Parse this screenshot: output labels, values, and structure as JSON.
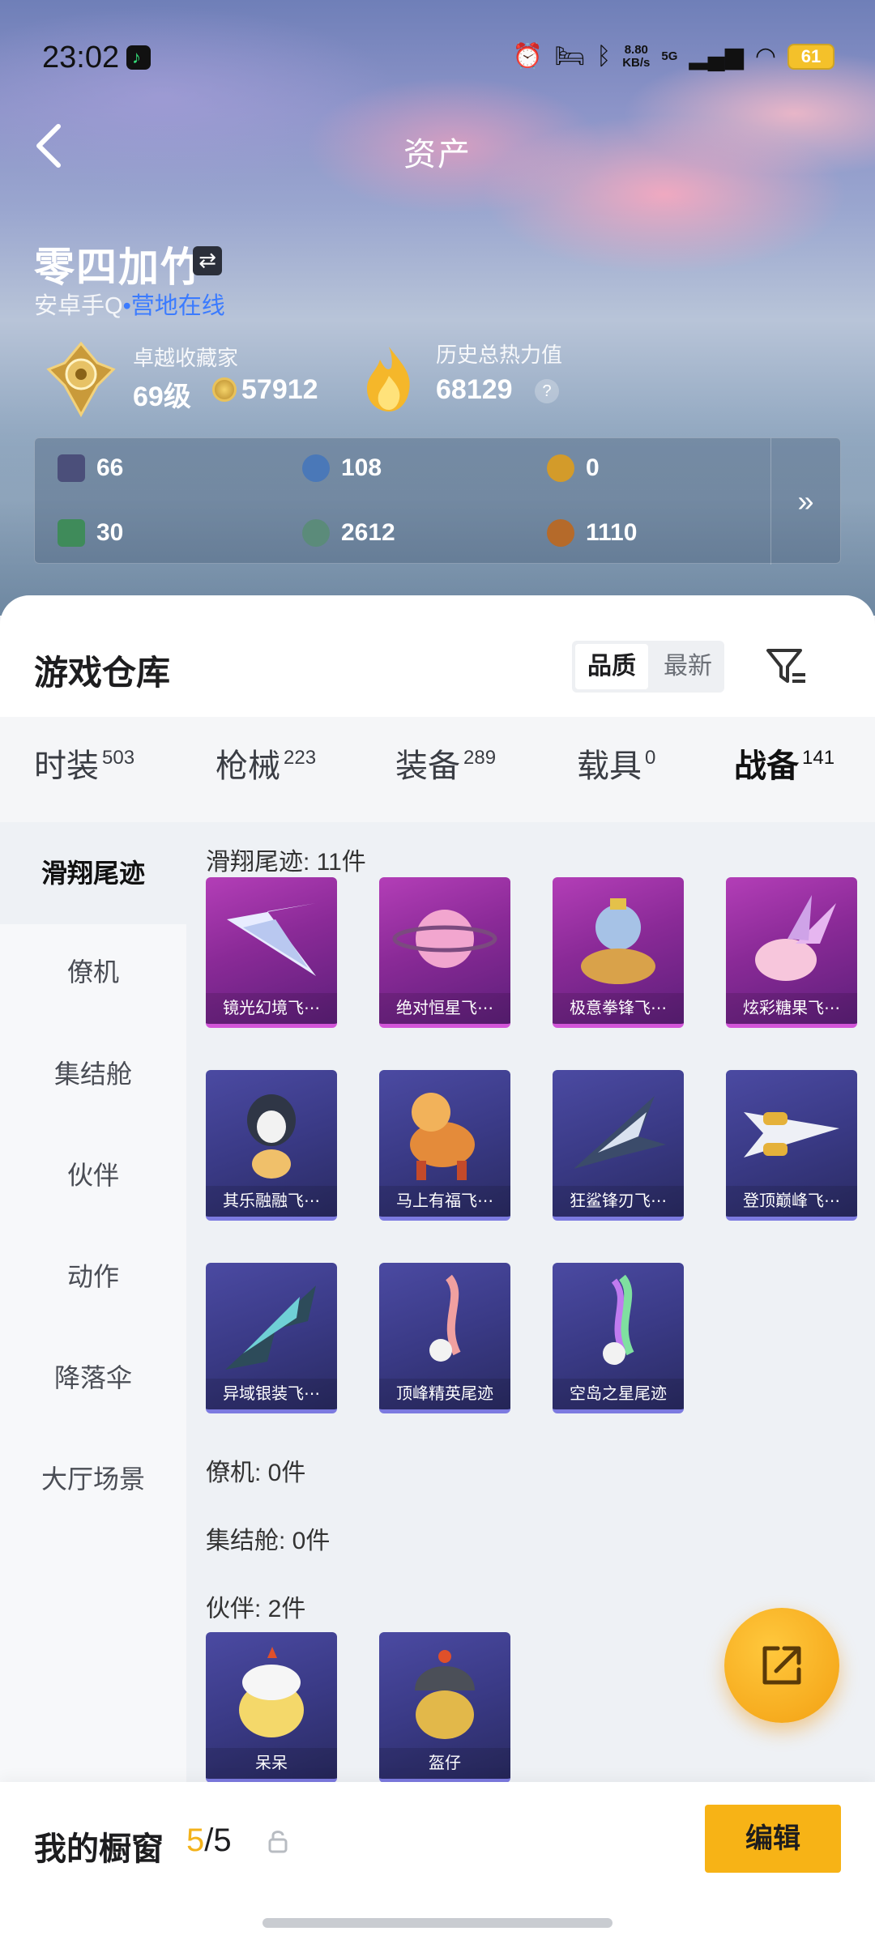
{
  "status_bar": {
    "time": "23:02",
    "net_speed_value": "8.80",
    "net_speed_unit": "KB/s",
    "network": "5G",
    "battery": "61",
    "icons": [
      "alarm-icon",
      "bed-icon",
      "bluetooth-icon",
      "signal-icon",
      "wifi-icon"
    ]
  },
  "header": {
    "title": "资产"
  },
  "profile": {
    "name": "零四加竹",
    "platform": "安卓手Q",
    "online_text": "•营地在线",
    "collector_label": "卓越收藏家",
    "level": "69级",
    "points": "57912",
    "heat_label": "历史总热力值",
    "heat_value": "68129",
    "help": "?"
  },
  "resources": [
    {
      "value": "66",
      "color": "#4b4f7a"
    },
    {
      "value": "108",
      "color": "#4a78b8"
    },
    {
      "value": "0",
      "color": "#d39b2a"
    },
    {
      "value": "30",
      "color": "#3f8b5a"
    },
    {
      "value": "2612",
      "color": "#5b8b7a"
    },
    {
      "value": "1110",
      "color": "#b56a2a"
    }
  ],
  "resources_more": "»",
  "warehouse": {
    "title": "游戏仓库",
    "sort_options": [
      "品质",
      "最新"
    ],
    "sort_selected": "品质"
  },
  "tabs": [
    {
      "label": "时装",
      "count": "503"
    },
    {
      "label": "枪械",
      "count": "223"
    },
    {
      "label": "装备",
      "count": "289"
    },
    {
      "label": "载具",
      "count": "0"
    },
    {
      "label": "战备",
      "count": "141",
      "active": true
    }
  ],
  "sidebar": [
    {
      "label": "滑翔尾迹",
      "active": true
    },
    {
      "label": "僚机"
    },
    {
      "label": "集结舱"
    },
    {
      "label": "伙伴"
    },
    {
      "label": "动作"
    },
    {
      "label": "降落伞"
    },
    {
      "label": "大厅场景"
    }
  ],
  "sections": {
    "trail_title": "滑翔尾迹: 11件",
    "wingman_title": "僚机: 0件",
    "capsule_title": "集结舱: 0件",
    "partner_title": "伙伴: 2件"
  },
  "trail_items": [
    {
      "label": "镜光幻境飞⋯",
      "rarity": "purple"
    },
    {
      "label": "绝对恒星飞⋯",
      "rarity": "purple"
    },
    {
      "label": "极意拳锋飞⋯",
      "rarity": "purple"
    },
    {
      "label": "炫彩糖果飞⋯",
      "rarity": "purple"
    },
    {
      "label": "其乐融融飞⋯",
      "rarity": "blue"
    },
    {
      "label": "马上有福飞⋯",
      "rarity": "blue"
    },
    {
      "label": "狂鲨锋刃飞⋯",
      "rarity": "blue"
    },
    {
      "label": "登顶巅峰飞⋯",
      "rarity": "blue"
    },
    {
      "label": "异域银装飞⋯",
      "rarity": "blue"
    },
    {
      "label": "顶峰精英尾迹",
      "rarity": "blue"
    },
    {
      "label": "空岛之星尾迹",
      "rarity": "blue"
    }
  ],
  "partner_items": [
    {
      "label": "呆呆",
      "rarity": "blue"
    },
    {
      "label": "盔仔",
      "rarity": "blue"
    }
  ],
  "showcase": {
    "title": "我的橱窗",
    "current": "5",
    "total": "/5",
    "edit_label": "编辑"
  }
}
